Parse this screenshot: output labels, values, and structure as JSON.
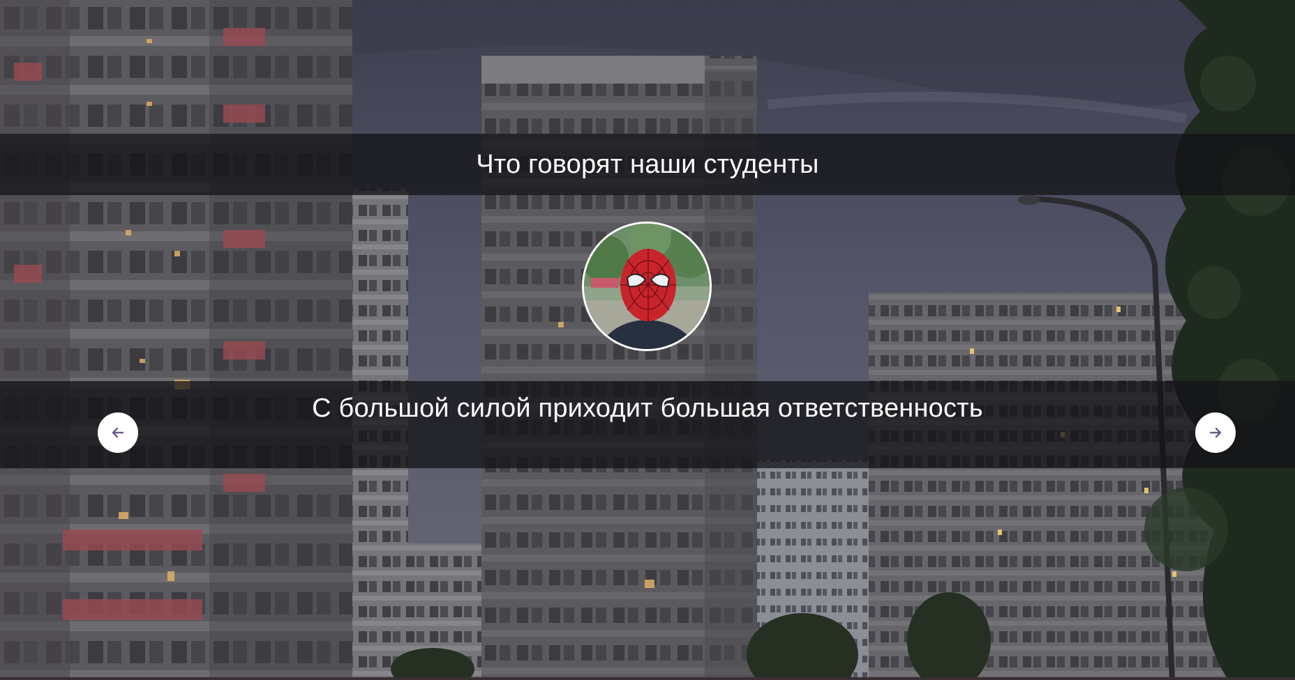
{
  "section": {
    "title": "Что говорят наши студенты"
  },
  "testimonial": {
    "quote": "С большой силой приходит большая ответственность",
    "avatar_icon": "spider-mask-avatar"
  },
  "controls": {
    "prev_icon": "arrow-left-icon",
    "next_icon": "arrow-right-icon",
    "arrow_color": "#6b5a86"
  },
  "colors": {
    "band": "#121216",
    "sky": "#4d4d5d",
    "text": "#ffffff"
  }
}
